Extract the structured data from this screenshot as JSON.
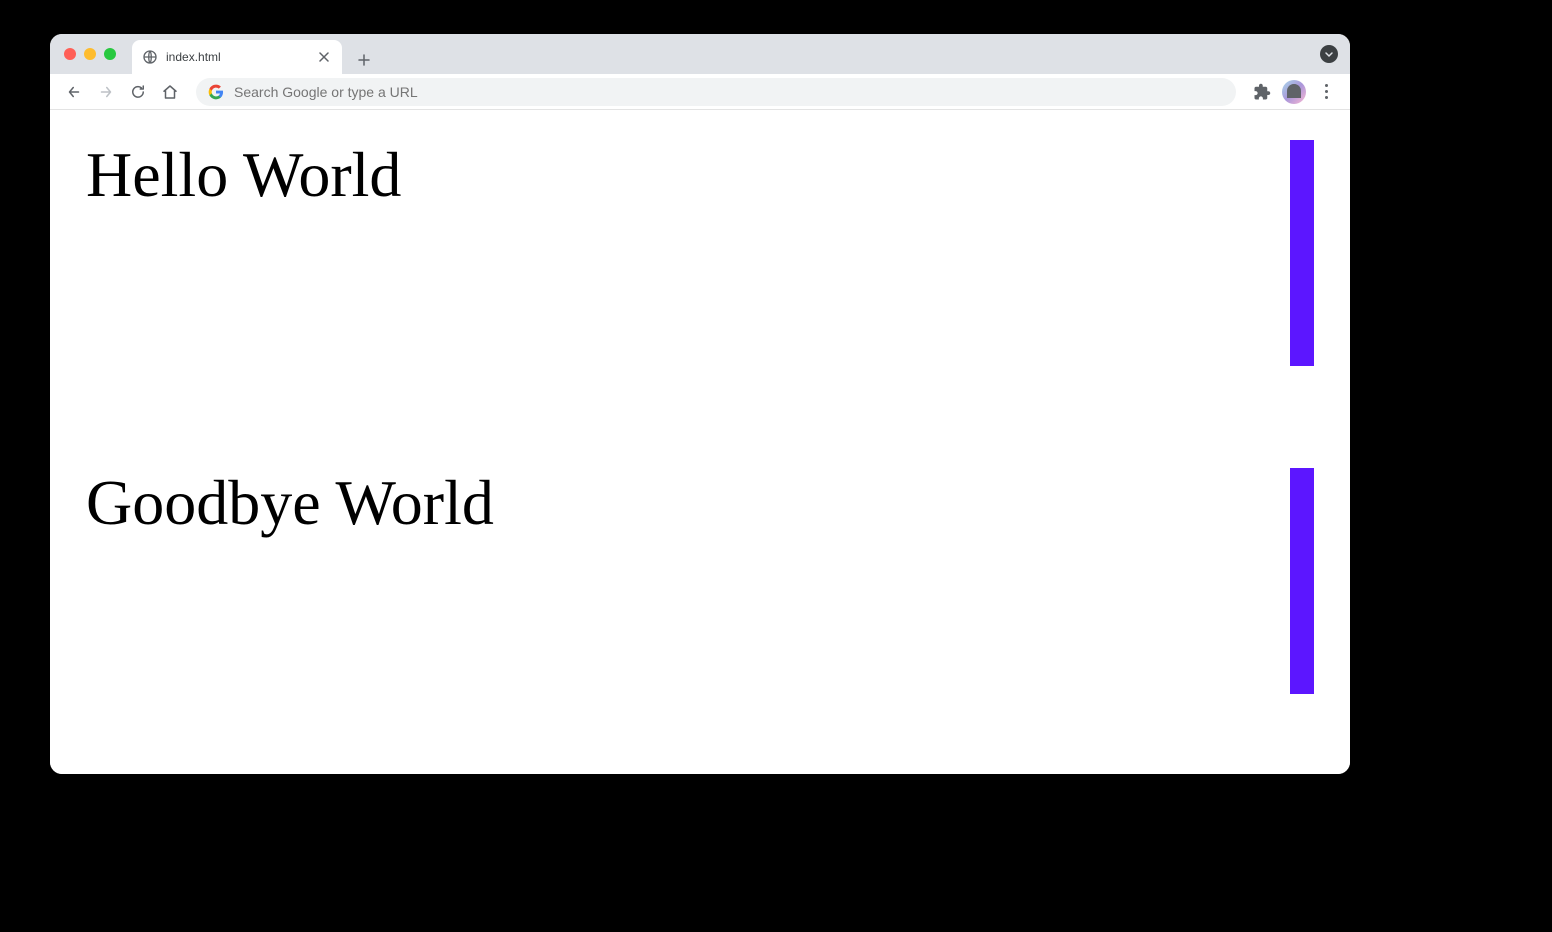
{
  "browser": {
    "tab": {
      "title": "index.html"
    },
    "omnibox": {
      "placeholder": "Search Google or type a URL"
    }
  },
  "page": {
    "sections": [
      {
        "heading": "Hello World"
      },
      {
        "heading": "Goodbye World"
      }
    ],
    "accent_color": "#5c16ff"
  }
}
